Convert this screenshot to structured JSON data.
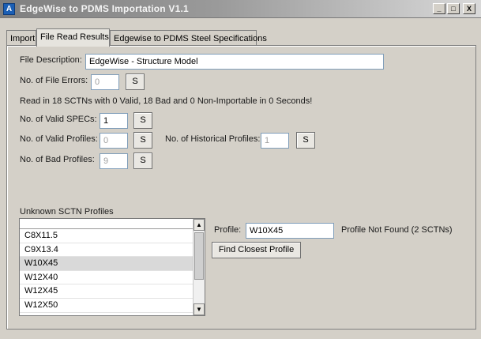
{
  "window": {
    "title": "EdgeWise to PDMS Importation V1.1",
    "minimize_label": "_",
    "maximize_label": "□",
    "close_label": "X"
  },
  "tabs": [
    {
      "label": "Import"
    },
    {
      "label": "File Read Results"
    },
    {
      "label": "Edgewise to PDMS Steel Specifications"
    }
  ],
  "file_description": {
    "label": "File Description:",
    "value": "EdgeWise - Structure Model"
  },
  "file_errors": {
    "label": "No. of File Errors:",
    "value": "0",
    "button": "S"
  },
  "summary_text": "Read in 18 SCTNs with 0 Valid, 18 Bad and 0 Non-Importable in 0 Seconds!",
  "valid_specs": {
    "label": "No. of Valid SPECs:",
    "value": "1",
    "button": "S"
  },
  "valid_profiles": {
    "label": "No. of Valid Profiles:",
    "value": "0",
    "button": "S"
  },
  "historical_profiles": {
    "label": "No. of Historical Profiles:",
    "value": "1",
    "button": "S"
  },
  "bad_profiles": {
    "label": "No. of Bad Profiles:",
    "value": "9",
    "button": "S"
  },
  "unknown_profiles": {
    "label": "Unknown SCTN Profiles",
    "items": [
      "C8X11.5",
      "C9X13.4",
      "W10X45",
      "W12X40",
      "W12X45",
      "W12X50"
    ],
    "selected_index": 2
  },
  "profile": {
    "label": "Profile:",
    "value": "W10X45",
    "status": "Profile Not Found (2 SCTNs)",
    "find_button": "Find Closest Profile"
  }
}
